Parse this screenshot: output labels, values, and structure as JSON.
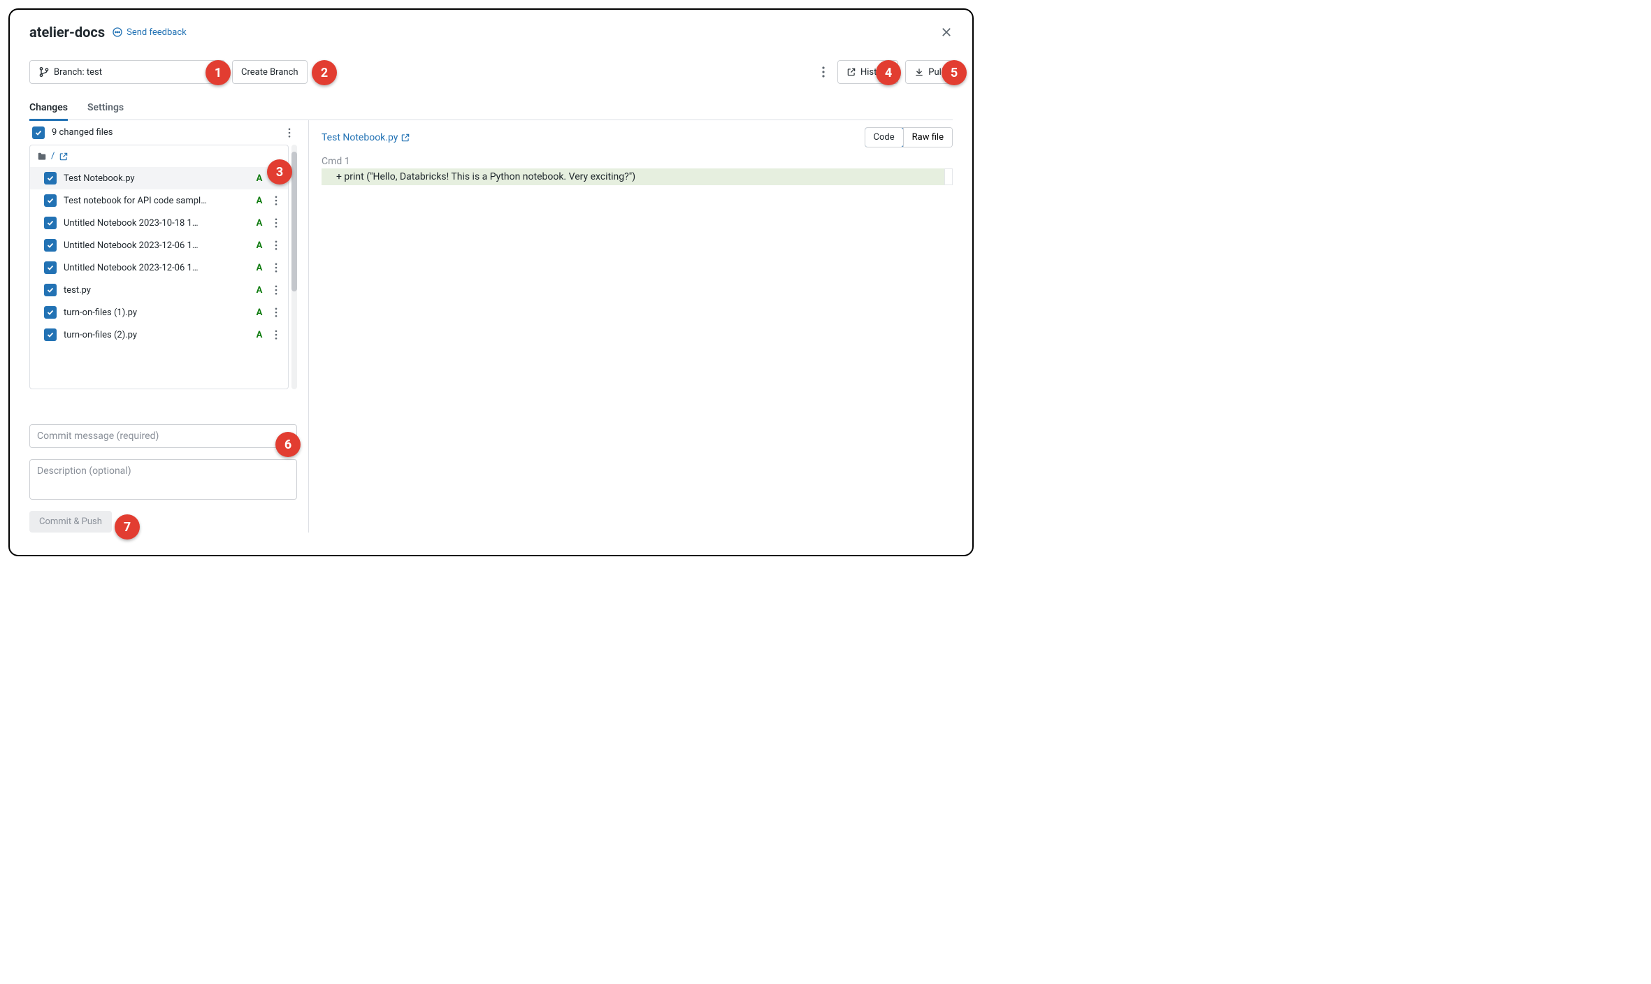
{
  "header": {
    "title": "atelier-docs",
    "feedback_label": "Send feedback"
  },
  "toolbar": {
    "branch_label": "Branch: test",
    "create_branch_label": "Create Branch",
    "history_label": "History",
    "pull_label": "Pull"
  },
  "tabs": {
    "changes": "Changes",
    "settings": "Settings"
  },
  "changed_files_header": "9 changed files",
  "folder_path": "/",
  "files": [
    {
      "name": "Test Notebook.py",
      "status": "A",
      "selected_row": true
    },
    {
      "name": "Test notebook for API code sampl…",
      "status": "A"
    },
    {
      "name": "Untitled Notebook 2023-10-18 1…",
      "status": "A"
    },
    {
      "name": "Untitled Notebook 2023-12-06 1…",
      "status": "A"
    },
    {
      "name": "Untitled Notebook 2023-12-06 1…",
      "status": "A"
    },
    {
      "name": "test.py",
      "status": "A"
    },
    {
      "name": "turn-on-files (1).py",
      "status": "A"
    },
    {
      "name": "turn-on-files (2).py",
      "status": "A"
    }
  ],
  "commit": {
    "message_placeholder": "Commit message (required)",
    "description_placeholder": "Description (optional)",
    "button_label": "Commit & Push"
  },
  "diff": {
    "file_name": "Test Notebook.py",
    "view_code": "Code",
    "view_raw": "Raw file",
    "cmd_label": "Cmd 1",
    "added_line": "+ print (\"Hello, Databricks! This is a Python notebook. Very exciting?\")"
  },
  "anno": {
    "1": "1",
    "2": "2",
    "3": "3",
    "4": "4",
    "5": "5",
    "6": "6",
    "7": "7"
  }
}
